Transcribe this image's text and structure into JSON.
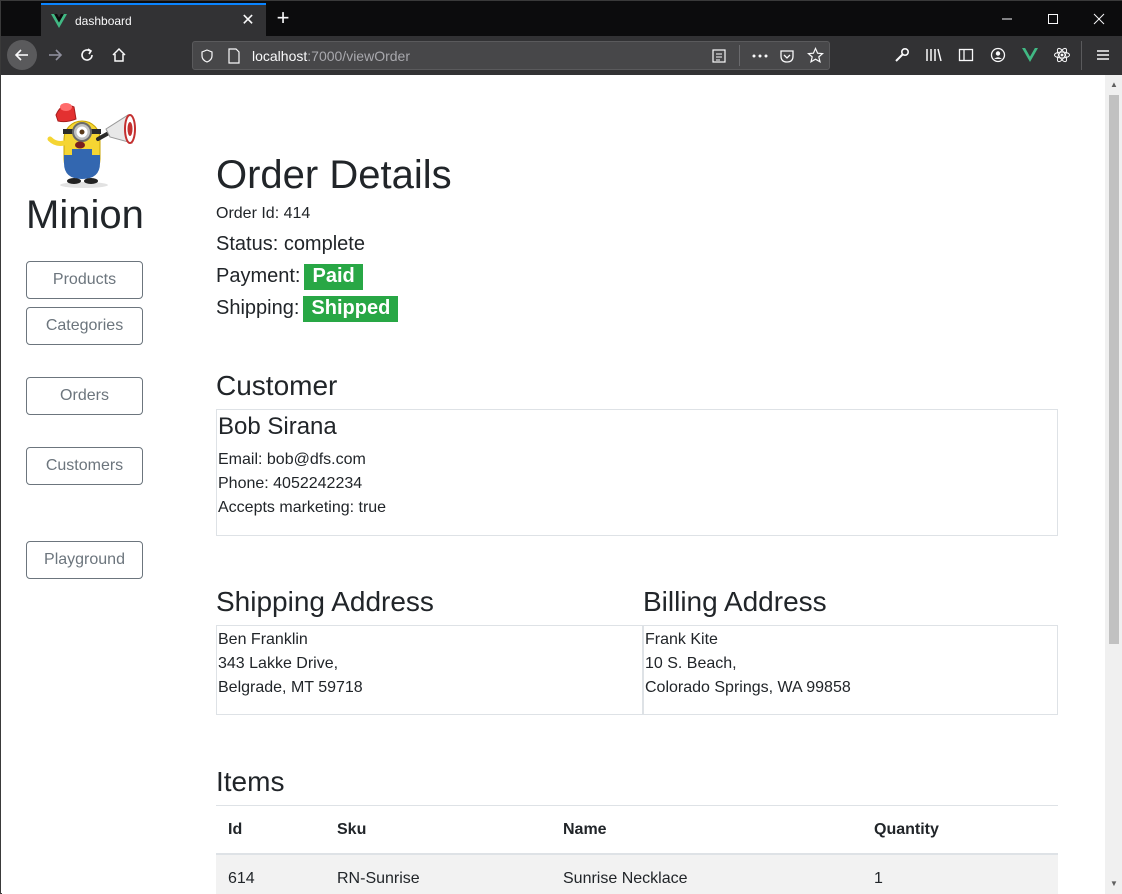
{
  "browser": {
    "tab_title": "dashboard",
    "url_host": "localhost",
    "url_rest": ":7000/viewOrder"
  },
  "sidebar": {
    "brand": "Minion",
    "items": [
      {
        "label": "Products"
      },
      {
        "label": "Categories"
      },
      {
        "label": "Orders"
      },
      {
        "label": "Customers"
      },
      {
        "label": "Playground"
      }
    ]
  },
  "order": {
    "title": "Order Details",
    "order_id": "Order Id: 414",
    "status": "Status: complete",
    "payment_label": "Payment:",
    "payment_badge": "Paid",
    "shipping_label": "Shipping:",
    "shipping_badge": "Shipped"
  },
  "customer": {
    "heading": "Customer",
    "name": "Bob Sirana",
    "email": "Email: bob@dfs.com",
    "phone": "Phone: 4052242234",
    "marketing": "Accepts marketing: true"
  },
  "shipping_address": {
    "heading": "Shipping Address",
    "name": "Ben Franklin",
    "street": "343 Lakke Drive,",
    "city": "Belgrade, MT 59718"
  },
  "billing_address": {
    "heading": "Billing Address",
    "name": "Frank Kite",
    "street": "10 S. Beach,",
    "city": "Colorado Springs, WA 99858"
  },
  "items": {
    "heading": "Items",
    "columns": [
      "Id",
      "Sku",
      "Name",
      "Quantity"
    ],
    "rows": [
      [
        "614",
        "RN-Sunrise",
        "Sunrise Necklace",
        "1"
      ]
    ]
  },
  "colors": {
    "badge_success": "#28a745",
    "tab_accent": "#0a84ff",
    "vue_green": "#41b883"
  }
}
